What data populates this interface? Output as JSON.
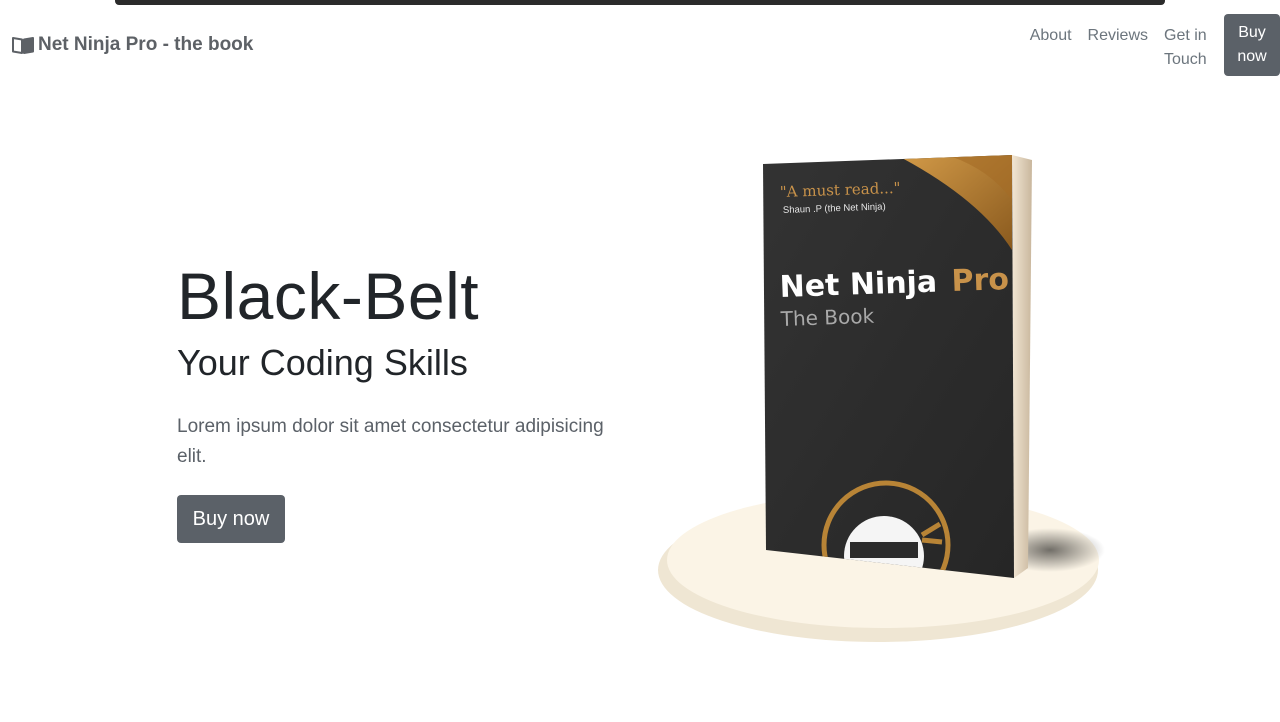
{
  "navbar": {
    "brand": "Net Ninja Pro - the book",
    "links": [
      "About",
      "Reviews",
      "Get in Touch"
    ],
    "cta": "Buy now"
  },
  "hero": {
    "title": "Black-Belt",
    "subtitle": "Your Coding Skills",
    "text": "Lorem ipsum dolor sit amet consectetur adipisicing elit.",
    "button": "Buy now"
  },
  "book": {
    "quote": "\"A must read...\"",
    "quote_author": "Shaun .P (the Net Ninja)",
    "title_main": "Net Ninja",
    "title_accent": "Pro",
    "subtitle": "The Book"
  },
  "colors": {
    "button_bg": "#5b6168",
    "book_cover": "#2c2c2c",
    "gold": "#c08a3a",
    "podium": "#f8f1e4"
  }
}
